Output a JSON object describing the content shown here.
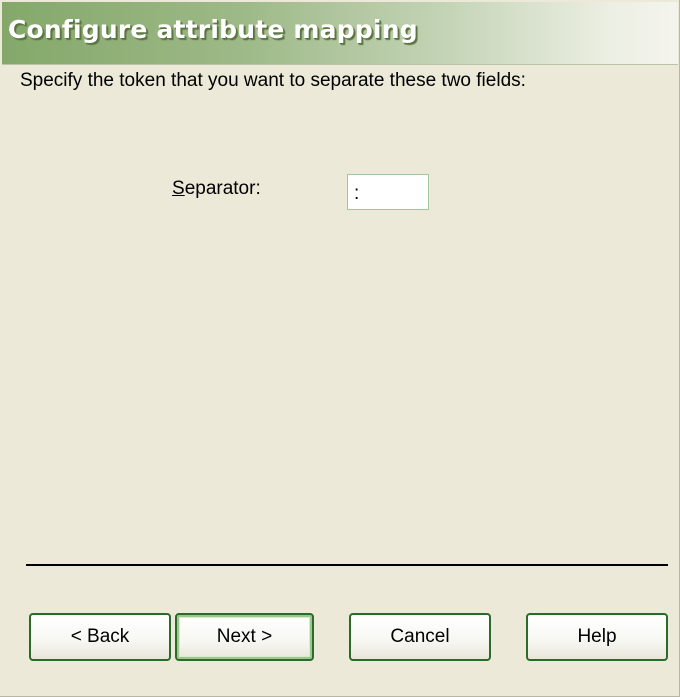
{
  "window": {
    "title": "Configure attribute mapping"
  },
  "main": {
    "instruction": "Specify the token that you want to separate these two fields:",
    "separator_label_mnemonic": "S",
    "separator_label_rest": "eparator:",
    "separator_value": ":"
  },
  "buttons": {
    "back": "< Back",
    "next": "Next >",
    "cancel": "Cancel",
    "help": "Help"
  },
  "colors": {
    "title_bar_accent": "#84a86a",
    "dialog_background": "#ece9d8",
    "button_border": "#2a6a2a"
  }
}
